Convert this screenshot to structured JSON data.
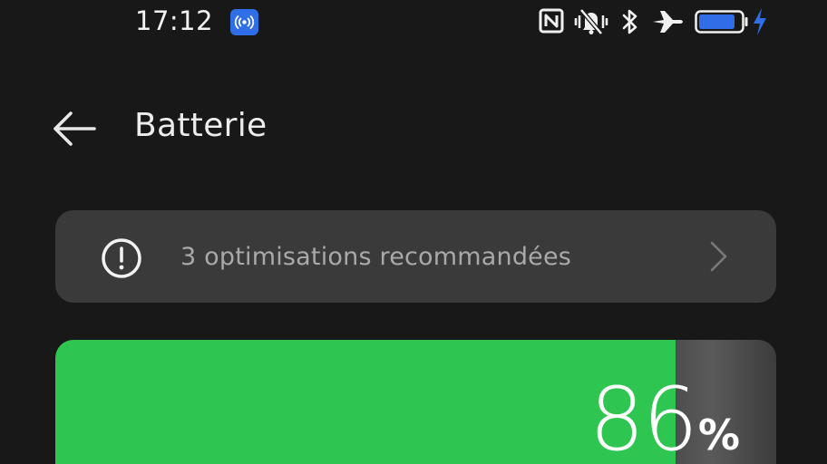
{
  "status_bar": {
    "time": "17:12",
    "icons": [
      "hotspot-icon",
      "nfc-icon",
      "vibrate-off-icon",
      "bluetooth-icon",
      "airplane-icon",
      "battery-icon",
      "charging-bolt-icon"
    ],
    "battery_level": 0.86,
    "accent_color": "#2f6ee6"
  },
  "header": {
    "title": "Batterie",
    "back_icon": "arrow-left-icon"
  },
  "recommendation": {
    "icon": "alert-circle-icon",
    "text": "3 optimisations recommandées",
    "chevron": "chevron-right-icon"
  },
  "battery": {
    "level_percent": 86,
    "value": "86",
    "unit": "%",
    "fill_color": "#2ec650"
  }
}
